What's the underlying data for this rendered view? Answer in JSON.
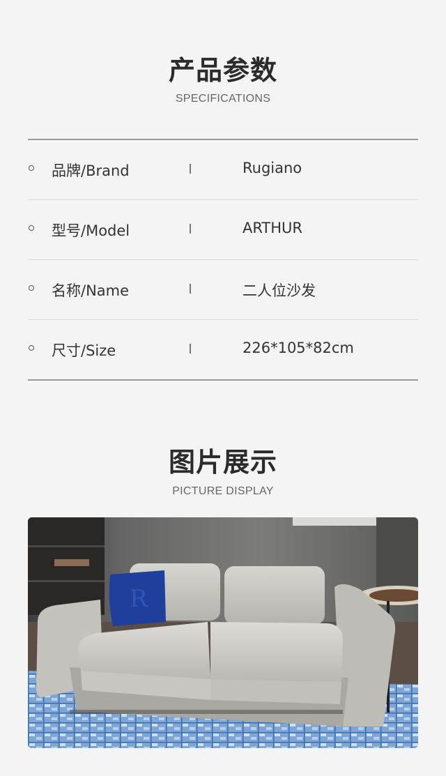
{
  "specifications": {
    "title": "产品参数",
    "subtitle": "SPECIFICATIONS",
    "rows": [
      {
        "label": "品牌/Brand",
        "value": "Rugiano"
      },
      {
        "label": "型号/Model",
        "value": "ARTHUR"
      },
      {
        "label": "名称/Name",
        "value": "二人位沙发"
      },
      {
        "label": "尺寸/Size",
        "value": "226*105*82cm"
      }
    ]
  },
  "gallery": {
    "title": "图片展示",
    "subtitle": "PICTURE DISPLAY",
    "image_subject": "light grey leather two-seat sofa with blue cushion on blue patterned rug",
    "colors": {
      "sofa": "#c9c8c2",
      "cushion": "#1e3f9c",
      "rug": "#6a95c8",
      "wall": "#6f6f6f"
    }
  }
}
